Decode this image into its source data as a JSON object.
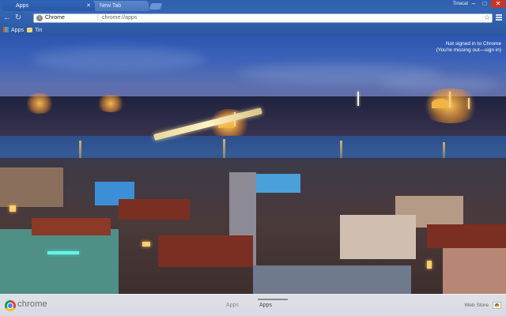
{
  "browser": {
    "tabs": [
      {
        "label": "Apps",
        "active": true
      },
      {
        "label": "New Tab",
        "active": false
      }
    ],
    "profile_name": "Tinacat",
    "address_bar": {
      "host": "Chrome",
      "separator": "|",
      "path": "chrome://apps"
    },
    "bookmarks": [
      {
        "label": "Apps",
        "icon": "apps-grid-icon"
      },
      {
        "label": "Tin",
        "icon": "folder-icon"
      }
    ],
    "window_controls": {
      "minimize": "–",
      "maximize": "□",
      "close": "✕"
    }
  },
  "signin": {
    "line1": "Not signed in to Chrome",
    "line2": "(You're missing out—sign in)"
  },
  "bottom_bar": {
    "brand": "chrome",
    "tabs": [
      {
        "label": "Apps",
        "active": false
      },
      {
        "label": "Apps",
        "active": true
      }
    ],
    "webstore_label": "Web Store"
  },
  "colors": {
    "tab_strip": "#2d5fae",
    "close_button": "#c9352b",
    "bottom_bar": "#e6e9f0"
  }
}
